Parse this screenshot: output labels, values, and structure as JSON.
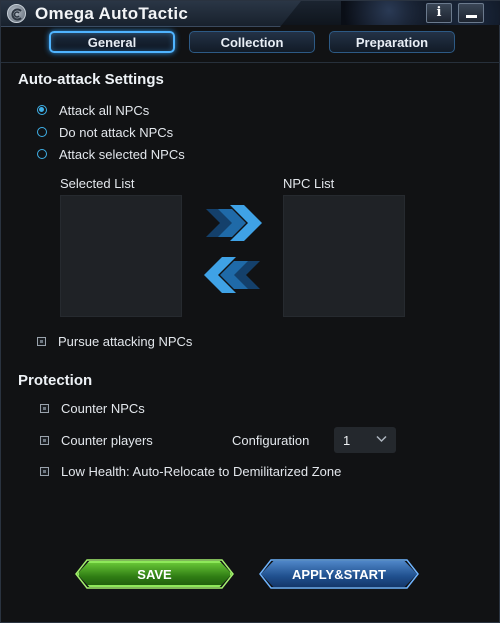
{
  "window": {
    "title": "Omega AutoTactic",
    "info_button": "i"
  },
  "tabs": [
    {
      "label": "General",
      "active": true
    },
    {
      "label": "Collection",
      "active": false
    },
    {
      "label": "Preparation",
      "active": false
    }
  ],
  "auto_attack": {
    "title": "Auto-attack Settings",
    "options": [
      {
        "label": "Attack all NPCs",
        "selected": true
      },
      {
        "label": "Do not attack NPCs",
        "selected": false
      },
      {
        "label": "Attack selected NPCs",
        "selected": false
      }
    ],
    "selected_list_label": "Selected List",
    "npc_list_label": "NPC List",
    "pursue_label": "Pursue attacking NPCs"
  },
  "protection": {
    "title": "Protection",
    "counter_npcs": "Counter NPCs",
    "counter_players": "Counter players",
    "configuration_label": "Configuration",
    "configuration_value": "1",
    "low_health": "Low Health: Auto-Relocate to Demilitarized Zone"
  },
  "buttons": {
    "save": "SAVE",
    "apply_start": "APPLY&START"
  },
  "colors": {
    "accent_blue": "#3fb0e8",
    "save_green": "#2f7d14",
    "apply_blue": "#1f4f8d"
  }
}
